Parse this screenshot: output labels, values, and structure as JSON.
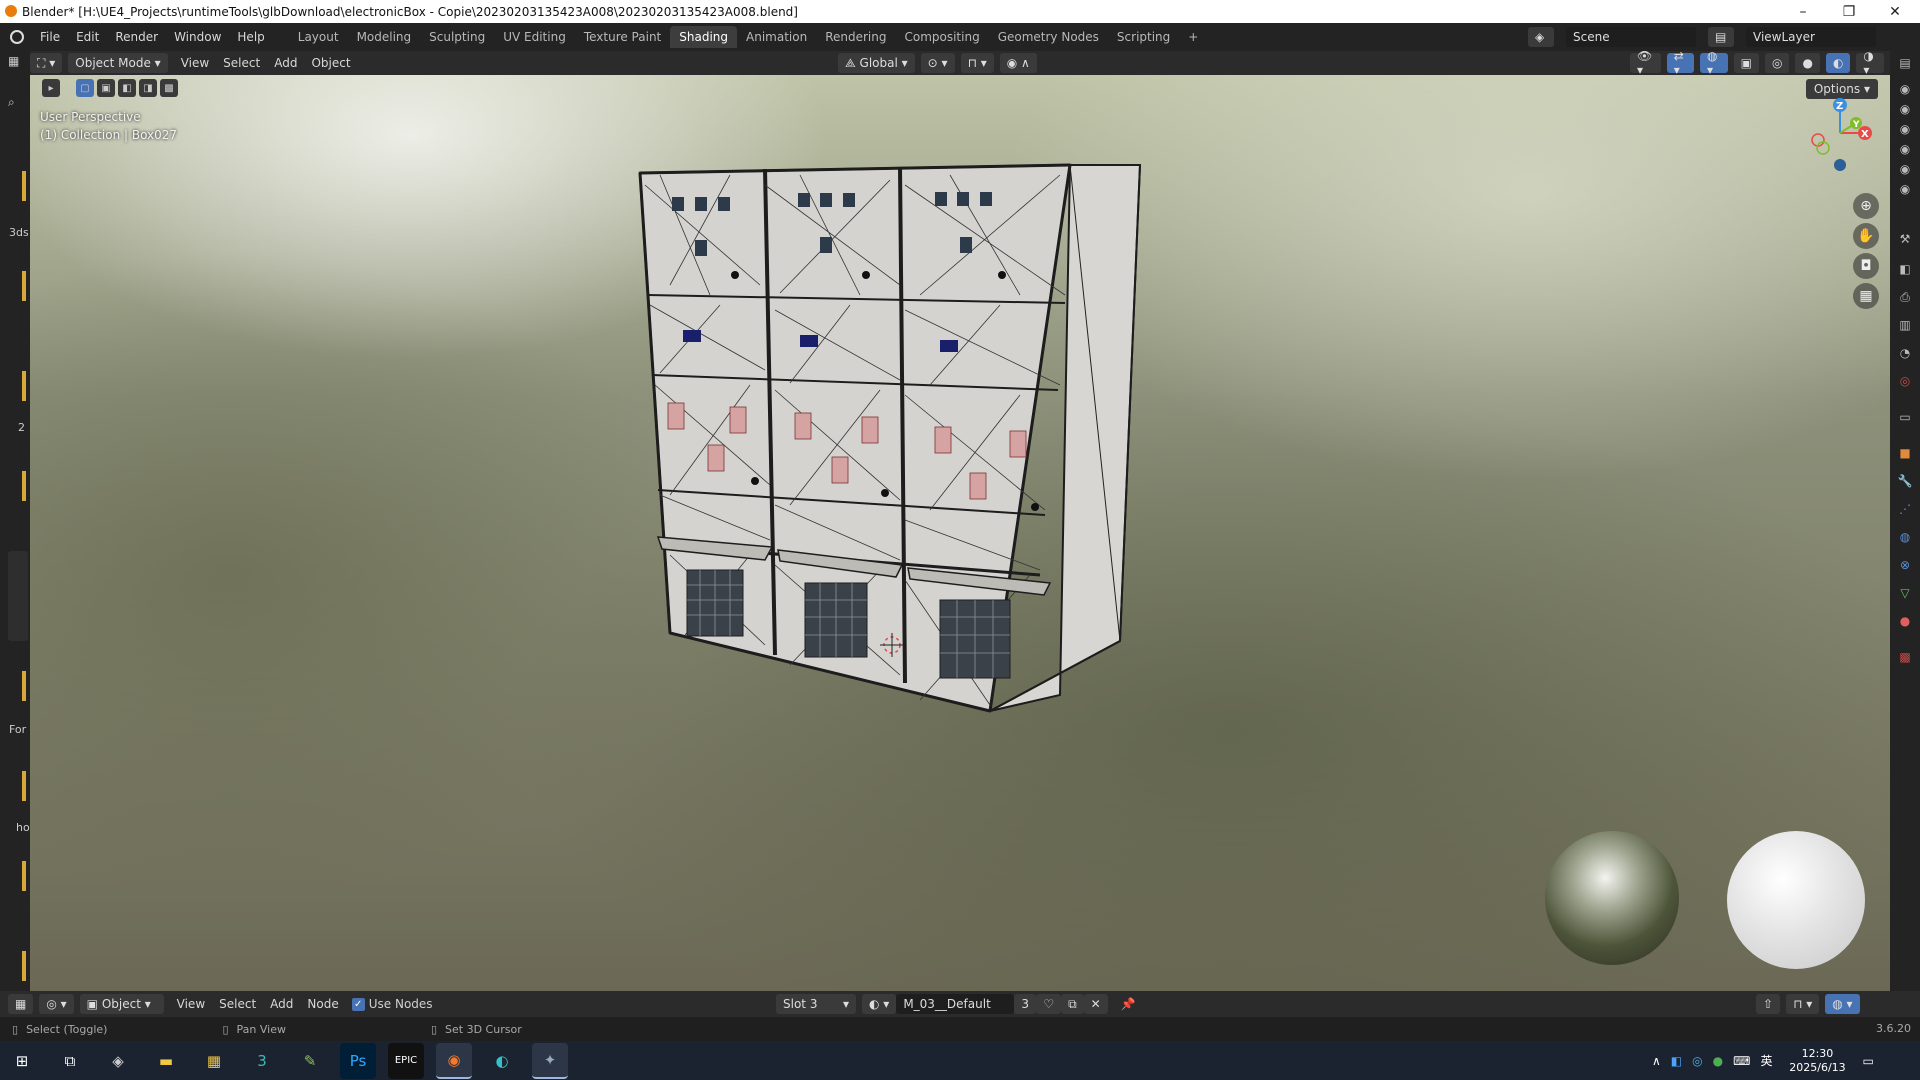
{
  "window": {
    "title": "Blender* [H:\\UE4_Projects\\runtimeTools\\glbDownload\\electronicBox - Copie\\20230203135423A008\\20230203135423A008.blend]",
    "minimize": "–",
    "maximize": "❐",
    "close": "✕"
  },
  "menu": [
    "File",
    "Edit",
    "Render",
    "Window",
    "Help"
  ],
  "workspaces": [
    "Layout",
    "Modeling",
    "Sculpting",
    "UV Editing",
    "Texture Paint",
    "Shading",
    "Animation",
    "Rendering",
    "Compositing",
    "Geometry Nodes",
    "Scripting",
    "+"
  ],
  "active_workspace": "Shading",
  "scene": {
    "label": "Scene",
    "view_layer": "ViewLayer"
  },
  "viewport_header": {
    "mode": "Object Mode",
    "menus": [
      "View",
      "Select",
      "Add",
      "Object"
    ],
    "transform_orientation": "Global",
    "options": "Options"
  },
  "viewport": {
    "perspective_label": "User Perspective",
    "collection_label": "(1) Collection | Box027",
    "gizmo": {
      "z": "Z",
      "y": "Y",
      "x": "X"
    }
  },
  "left_strip_labels": [
    "3ds",
    "2",
    "For",
    "ho"
  ],
  "node_header": {
    "editor_mode": "Object",
    "menus": [
      "View",
      "Select",
      "Add",
      "Node"
    ],
    "use_nodes_label": "Use Nodes",
    "use_nodes_checked": true,
    "slot": "Slot 3",
    "material": "M_03__Default",
    "users": "3"
  },
  "statusbar": {
    "select": "Select (Toggle)",
    "pan": "Pan View",
    "cursor": "Set 3D Cursor",
    "version": "3.6.20"
  },
  "taskbar": {
    "time": "12:30",
    "date": "2025/6/13",
    "ime": "英"
  },
  "colors": {
    "accent": "#4772b3",
    "gizmo_x": "#e84a4a",
    "gizmo_y": "#7fbd29",
    "gizmo_z": "#3d8fe0"
  }
}
